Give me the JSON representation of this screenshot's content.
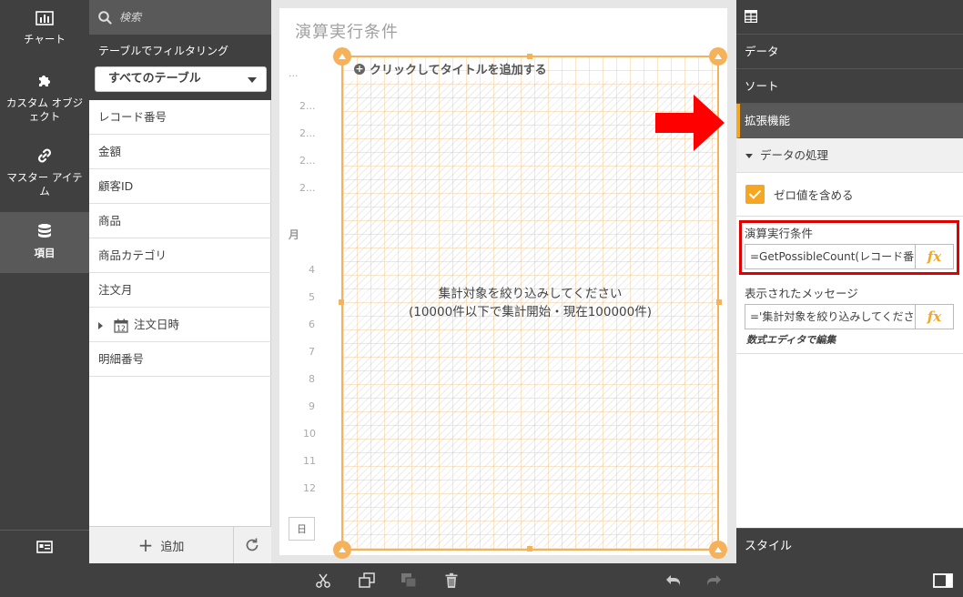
{
  "left_nav": {
    "items": [
      {
        "label": "チャート",
        "icon": "bar-chart-icon"
      },
      {
        "label": "カスタム オブジェクト",
        "icon": "puzzle-icon"
      },
      {
        "label": "マスター アイテム",
        "icon": "link-icon"
      },
      {
        "label": "項目",
        "icon": "database-icon",
        "active": true
      }
    ],
    "bottom_icon": "id-card-icon"
  },
  "field_panel": {
    "search_placeholder": "検索",
    "filter_label": "テーブルでフィルタリング",
    "filter_value": "すべてのテーブル",
    "fields": [
      {
        "label": "レコード番号"
      },
      {
        "label": "金額"
      },
      {
        "label": "顧客ID"
      },
      {
        "label": "商品"
      },
      {
        "label": "商品カテゴリ"
      },
      {
        "label": "注文月"
      },
      {
        "label": "注文日時",
        "icon": "calendar-icon",
        "calendar_number": "12"
      },
      {
        "label": "明細番号"
      }
    ],
    "add_label": "追加"
  },
  "sheet": {
    "title": "演算実行条件",
    "background_labels": {
      "top": "...",
      "rows": [
        "2...",
        "2...",
        "2...",
        "2..."
      ],
      "month_header": "月",
      "months": [
        "4",
        "5",
        "6",
        "7",
        "8",
        "9",
        "10",
        "11",
        "12"
      ],
      "day_header": "日"
    },
    "viz": {
      "add_title": "クリックしてタイトルを追加する",
      "message_line1": "集計対象を絞り込みしてください",
      "message_line2": "(10000件以下で集計開始・現在100000件)"
    }
  },
  "prop_panel": {
    "tabs": [
      {
        "label": "データ"
      },
      {
        "label": "ソート"
      },
      {
        "label": "拡張機能",
        "active": true
      }
    ],
    "section_header": "データの処理",
    "zero_checkbox_label": "ゼロ値を含める",
    "zero_checked": true,
    "calc_condition_label": "演算実行条件",
    "calc_condition_value": "=GetPossibleCount(レコード番",
    "message_label": "表示されたメッセージ",
    "message_value": "='集計対象を絞り込みしてくださ",
    "fx_label": "fx",
    "editor_link": "数式エディタで編集",
    "style_tab": "スタイル"
  },
  "toolbar": {
    "icons": [
      "scissors-icon",
      "copy-icon",
      "paste-icon",
      "trash-icon",
      "undo-icon",
      "redo-icon",
      "panel-toggle-icon"
    ]
  },
  "colors": {
    "dark": "#404040",
    "accent": "#f5a623",
    "highlight": "#e00000",
    "arrow": "#ff0000",
    "viz_border": "#f5b25a"
  }
}
